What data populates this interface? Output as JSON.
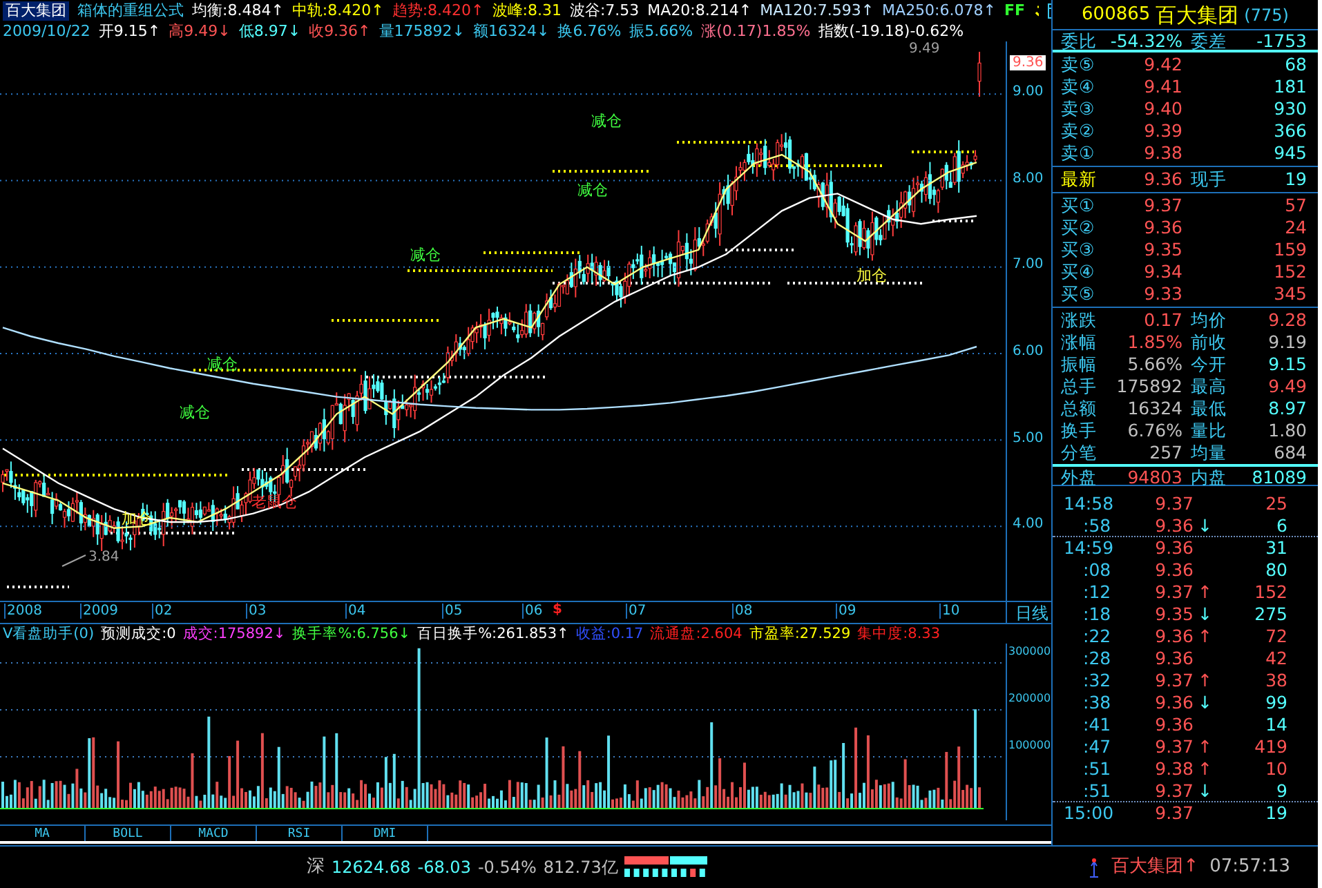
{
  "header": {
    "stock": "百大集团",
    "formula": "箱体的重组公式",
    "flag": "FF",
    "indicators": [
      {
        "text": "均衡:8.484↑",
        "color": "#ffffff"
      },
      {
        "text": "中轨:8.420↑",
        "color": "#ffff00"
      },
      {
        "text": "趋势:8.420↑",
        "color": "#ff3030"
      },
      {
        "text": "波峰:8.31",
        "color": "#ffff00"
      },
      {
        "text": "波谷:7.53",
        "color": "#ffffff"
      },
      {
        "text": "MA20:8.214↑",
        "color": "#ffffff"
      },
      {
        "text": "MA120:7.593↑",
        "color": "#c8e8ff"
      },
      {
        "text": "MA250:6.078↑",
        "color": "#a0d0ff"
      }
    ],
    "date": "2009/10/22",
    "fields": [
      {
        "text": "开9.15↑",
        "color": "#ffffff"
      },
      {
        "text": "高9.49↓",
        "color": "#ff5454"
      },
      {
        "text": "低8.97↓",
        "color": "#54ffff"
      },
      {
        "text": "收9.36↑",
        "color": "#ff5454"
      },
      {
        "text": "量175892↓",
        "color": "#3cc8f0"
      },
      {
        "text": "额16324↓",
        "color": "#3cc8f0"
      },
      {
        "text": "换6.76%",
        "color": "#3cc8f0"
      },
      {
        "text": "振5.66%",
        "color": "#3cc8f0"
      },
      {
        "text": "涨(0.17)1.85%",
        "color": "#ff7090"
      },
      {
        "text": "指数(-19.18)-0.62%",
        "color": "#ffffff"
      }
    ]
  },
  "chart": {
    "last_price": "9.36",
    "high_label": "9.49",
    "low_label": "3.84",
    "chart_data": {
      "type": "line",
      "ylim": [
        3.14,
        9.61
      ],
      "grid": true,
      "yticks": [
        {
          "value": 9,
          "label": "9.00"
        },
        {
          "value": 8,
          "label": "8.00"
        },
        {
          "value": 7,
          "label": "7.00"
        },
        {
          "value": 6,
          "label": "6.00"
        },
        {
          "value": 5,
          "label": "5.00"
        },
        {
          "value": 4,
          "label": "4.00"
        }
      ],
      "series": [
        {
          "color": "#ffff80",
          "values": [
            4.5,
            4.4,
            4.3,
            4.1,
            3.98,
            4.0,
            4.1,
            4.05,
            4.2,
            4.4,
            4.6,
            4.9,
            5.3,
            5.5,
            5.3,
            5.6,
            5.9,
            6.3,
            6.4,
            6.3,
            6.8,
            7.0,
            6.8,
            7.0,
            7.1,
            7.2,
            7.9,
            8.2,
            8.3,
            8.1,
            7.5,
            7.3,
            7.6,
            7.9,
            8.1,
            8.21
          ]
        },
        {
          "color": "#ffffff",
          "values": [
            4.9,
            4.7,
            4.5,
            4.35,
            4.2,
            4.1,
            4.05,
            4.05,
            4.08,
            4.15,
            4.25,
            4.4,
            4.6,
            4.8,
            4.95,
            5.1,
            5.3,
            5.5,
            5.75,
            5.95,
            6.2,
            6.4,
            6.6,
            6.75,
            6.9,
            7.0,
            7.15,
            7.4,
            7.65,
            7.8,
            7.85,
            7.7,
            7.55,
            7.5,
            7.55,
            7.59
          ]
        },
        {
          "color": "#b0e0ff",
          "values": [
            6.3,
            6.2,
            6.12,
            6.05,
            5.97,
            5.9,
            5.83,
            5.77,
            5.71,
            5.65,
            5.6,
            5.55,
            5.5,
            5.47,
            5.44,
            5.41,
            5.39,
            5.37,
            5.36,
            5.35,
            5.35,
            5.36,
            5.38,
            5.4,
            5.43,
            5.47,
            5.51,
            5.56,
            5.62,
            5.68,
            5.74,
            5.8,
            5.86,
            5.92,
            5.98,
            6.08
          ]
        }
      ]
    },
    "signals": [
      {
        "text": "减仓",
        "kind": "reduce"
      },
      {
        "text": "减仓",
        "kind": "reduce"
      },
      {
        "text": "减仓",
        "kind": "reduce"
      },
      {
        "text": "减仓",
        "kind": "reduce"
      },
      {
        "text": "减仓",
        "kind": "reduce"
      },
      {
        "text": "加仓",
        "kind": "add"
      },
      {
        "text": "加仓",
        "kind": "add"
      },
      {
        "text": "老鼠仓",
        "kind": "alert"
      }
    ]
  },
  "time_axis": {
    "labels": [
      "2008",
      "2009",
      "02",
      "03",
      "04",
      "05",
      "06",
      "07",
      "08",
      "09",
      "10"
    ],
    "marker": "$",
    "period": "日线"
  },
  "volume": {
    "items": [
      {
        "text": "V看盘助手(0)",
        "color": "#3cc8f0"
      },
      {
        "text": "预测成交:0",
        "color": "#ffffff"
      },
      {
        "text": "成交:175892↓",
        "color": "#ff40ff"
      },
      {
        "text": "换手率%:6.756↓",
        "color": "#40ff40"
      },
      {
        "text": "百日换手%:261.853↑",
        "color": "#ffffff"
      },
      {
        "text": "收益:0.17",
        "color": "#3050ff"
      },
      {
        "text": "流通盘:2.604",
        "color": "#ff2020"
      },
      {
        "text": "市盈率:27.529",
        "color": "#ffff00"
      },
      {
        "text": "集中度:8.33",
        "color": "#ff2020"
      }
    ],
    "axis": [
      "300000",
      "200000",
      "100000"
    ]
  },
  "tabs": [
    {
      "label": "MA"
    },
    {
      "label": "BOLL"
    },
    {
      "label": "MACD"
    },
    {
      "label": "RSI"
    },
    {
      "label": "DMI"
    }
  ],
  "quote": {
    "code": "600865",
    "name": "百大集团",
    "count": "(775)",
    "ratio": {
      "label": "委比",
      "value": "-54.32%",
      "label2": "委差",
      "value2": "-1753"
    },
    "asks": [
      {
        "label": "卖⑤",
        "price": "9.42",
        "volume": "68"
      },
      {
        "label": "卖④",
        "price": "9.41",
        "volume": "181"
      },
      {
        "label": "卖③",
        "price": "9.40",
        "volume": "930"
      },
      {
        "label": "卖②",
        "price": "9.39",
        "volume": "366"
      },
      {
        "label": "卖①",
        "price": "9.38",
        "volume": "945"
      }
    ],
    "last": {
      "label": "最新",
      "price": "9.36",
      "label2": "现手",
      "volume": "19"
    },
    "bids": [
      {
        "label": "买①",
        "price": "9.37",
        "volume": "57"
      },
      {
        "label": "买②",
        "price": "9.36",
        "volume": "24"
      },
      {
        "label": "买③",
        "price": "9.35",
        "volume": "159"
      },
      {
        "label": "买④",
        "price": "9.34",
        "volume": "152"
      },
      {
        "label": "买⑤",
        "price": "9.33",
        "volume": "345"
      }
    ],
    "stats": [
      {
        "label": "涨跌",
        "value": "0.17",
        "color": "#ff5454"
      },
      {
        "label": "均价",
        "value": "9.28",
        "color": "#ff5454"
      },
      {
        "label": "涨幅",
        "value": "1.85%",
        "color": "#ff5454"
      },
      {
        "label": "前收",
        "value": "9.19",
        "color": "#c0c0c0"
      },
      {
        "label": "振幅",
        "value": "5.66%",
        "color": "#c0c0c0"
      },
      {
        "label": "今开",
        "value": "9.15",
        "color": "#54ffff"
      },
      {
        "label": "总手",
        "value": "175892",
        "color": "#c0c0c0"
      },
      {
        "label": "最高",
        "value": "9.49",
        "color": "#ff5454"
      },
      {
        "label": "总额",
        "value": "16324",
        "color": "#c0c0c0"
      },
      {
        "label": "最低",
        "value": "8.97",
        "color": "#54ffff"
      },
      {
        "label": "换手",
        "value": "6.76%",
        "color": "#c0c0c0"
      },
      {
        "label": "量比",
        "value": "1.80",
        "color": "#c0c0c0"
      },
      {
        "label": "分笔",
        "value": "257",
        "color": "#c0c0c0"
      },
      {
        "label": "均量",
        "value": "684",
        "color": "#c0c0c0"
      }
    ],
    "outer": {
      "label": "外盘",
      "value": "94803",
      "label2": "内盘",
      "value2": "81089"
    },
    "ticks": [
      {
        "time": "14:58",
        "price": "9.37",
        "volume": "25",
        "color": "#ff5454",
        "divider_before": false
      },
      {
        "time": ":58",
        "price": "9.36",
        "arrow": {
          "text": "↓",
          "color": "#54ffff"
        },
        "volume": "6",
        "color": "#54ffff",
        "divider_before": false
      },
      {
        "time": "14:59",
        "price": "9.36",
        "volume": "31",
        "color": "#54ffff",
        "divider_before": true
      },
      {
        "time": ":08",
        "price": "9.36",
        "volume": "80",
        "color": "#54ffff",
        "divider_before": false
      },
      {
        "time": ":12",
        "price": "9.37",
        "arrow": {
          "text": "↑",
          "color": "#ff5454"
        },
        "volume": "152",
        "color": "#ff5454",
        "divider_before": false
      },
      {
        "time": ":18",
        "price": "9.35",
        "arrow": {
          "text": "↓",
          "color": "#54ffff"
        },
        "volume": "275",
        "color": "#54ffff",
        "divider_before": false
      },
      {
        "time": ":22",
        "price": "9.36",
        "arrow": {
          "text": "↑",
          "color": "#ff5454"
        },
        "volume": "72",
        "color": "#ff5454",
        "divider_before": false
      },
      {
        "time": ":28",
        "price": "9.36",
        "volume": "42",
        "color": "#ff5454",
        "divider_before": false
      },
      {
        "time": ":32",
        "price": "9.37",
        "arrow": {
          "text": "↑",
          "color": "#ff5454"
        },
        "volume": "38",
        "color": "#ff5454",
        "divider_before": false
      },
      {
        "time": ":38",
        "price": "9.36",
        "arrow": {
          "text": "↓",
          "color": "#54ffff"
        },
        "volume": "99",
        "color": "#54ffff",
        "divider_before": false
      },
      {
        "time": ":41",
        "price": "9.36",
        "volume": "14",
        "color": "#54ffff",
        "divider_before": false
      },
      {
        "time": ":47",
        "price": "9.37",
        "arrow": {
          "text": "↑",
          "color": "#ff5454"
        },
        "volume": "419",
        "color": "#ff5454",
        "divider_before": false
      },
      {
        "time": ":51",
        "price": "9.38",
        "arrow": {
          "text": "↑",
          "color": "#ff5454"
        },
        "volume": "10",
        "color": "#ff5454",
        "divider_before": false
      },
      {
        "time": ":51",
        "price": "9.37",
        "arrow": {
          "text": "↓",
          "color": "#54ffff"
        },
        "volume": "9",
        "color": "#54ffff",
        "divider_before": false
      },
      {
        "time": "15:00",
        "price": "9.37",
        "volume": "19",
        "color": "#54ffff",
        "divider_before": true
      }
    ]
  },
  "status": {
    "market": "深",
    "index": "12624.68",
    "change": "-68.03",
    "percent": "-0.54%",
    "amount": "812.73亿",
    "stock": "百大集团↑",
    "clock": "07:57:13"
  }
}
